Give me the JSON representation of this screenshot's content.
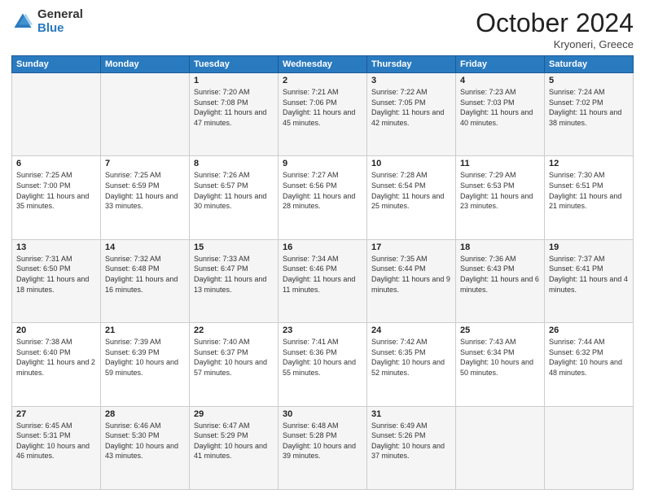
{
  "logo": {
    "general": "General",
    "blue": "Blue"
  },
  "header": {
    "month": "October 2024",
    "location": "Kryoneri, Greece"
  },
  "weekdays": [
    "Sunday",
    "Monday",
    "Tuesday",
    "Wednesday",
    "Thursday",
    "Friday",
    "Saturday"
  ],
  "weeks": [
    [
      {
        "day": "",
        "text": ""
      },
      {
        "day": "",
        "text": ""
      },
      {
        "day": "1",
        "text": "Sunrise: 7:20 AM\nSunset: 7:08 PM\nDaylight: 11 hours and 47 minutes."
      },
      {
        "day": "2",
        "text": "Sunrise: 7:21 AM\nSunset: 7:06 PM\nDaylight: 11 hours and 45 minutes."
      },
      {
        "day": "3",
        "text": "Sunrise: 7:22 AM\nSunset: 7:05 PM\nDaylight: 11 hours and 42 minutes."
      },
      {
        "day": "4",
        "text": "Sunrise: 7:23 AM\nSunset: 7:03 PM\nDaylight: 11 hours and 40 minutes."
      },
      {
        "day": "5",
        "text": "Sunrise: 7:24 AM\nSunset: 7:02 PM\nDaylight: 11 hours and 38 minutes."
      }
    ],
    [
      {
        "day": "6",
        "text": "Sunrise: 7:25 AM\nSunset: 7:00 PM\nDaylight: 11 hours and 35 minutes."
      },
      {
        "day": "7",
        "text": "Sunrise: 7:25 AM\nSunset: 6:59 PM\nDaylight: 11 hours and 33 minutes."
      },
      {
        "day": "8",
        "text": "Sunrise: 7:26 AM\nSunset: 6:57 PM\nDaylight: 11 hours and 30 minutes."
      },
      {
        "day": "9",
        "text": "Sunrise: 7:27 AM\nSunset: 6:56 PM\nDaylight: 11 hours and 28 minutes."
      },
      {
        "day": "10",
        "text": "Sunrise: 7:28 AM\nSunset: 6:54 PM\nDaylight: 11 hours and 25 minutes."
      },
      {
        "day": "11",
        "text": "Sunrise: 7:29 AM\nSunset: 6:53 PM\nDaylight: 11 hours and 23 minutes."
      },
      {
        "day": "12",
        "text": "Sunrise: 7:30 AM\nSunset: 6:51 PM\nDaylight: 11 hours and 21 minutes."
      }
    ],
    [
      {
        "day": "13",
        "text": "Sunrise: 7:31 AM\nSunset: 6:50 PM\nDaylight: 11 hours and 18 minutes."
      },
      {
        "day": "14",
        "text": "Sunrise: 7:32 AM\nSunset: 6:48 PM\nDaylight: 11 hours and 16 minutes."
      },
      {
        "day": "15",
        "text": "Sunrise: 7:33 AM\nSunset: 6:47 PM\nDaylight: 11 hours and 13 minutes."
      },
      {
        "day": "16",
        "text": "Sunrise: 7:34 AM\nSunset: 6:46 PM\nDaylight: 11 hours and 11 minutes."
      },
      {
        "day": "17",
        "text": "Sunrise: 7:35 AM\nSunset: 6:44 PM\nDaylight: 11 hours and 9 minutes."
      },
      {
        "day": "18",
        "text": "Sunrise: 7:36 AM\nSunset: 6:43 PM\nDaylight: 11 hours and 6 minutes."
      },
      {
        "day": "19",
        "text": "Sunrise: 7:37 AM\nSunset: 6:41 PM\nDaylight: 11 hours and 4 minutes."
      }
    ],
    [
      {
        "day": "20",
        "text": "Sunrise: 7:38 AM\nSunset: 6:40 PM\nDaylight: 11 hours and 2 minutes."
      },
      {
        "day": "21",
        "text": "Sunrise: 7:39 AM\nSunset: 6:39 PM\nDaylight: 10 hours and 59 minutes."
      },
      {
        "day": "22",
        "text": "Sunrise: 7:40 AM\nSunset: 6:37 PM\nDaylight: 10 hours and 57 minutes."
      },
      {
        "day": "23",
        "text": "Sunrise: 7:41 AM\nSunset: 6:36 PM\nDaylight: 10 hours and 55 minutes."
      },
      {
        "day": "24",
        "text": "Sunrise: 7:42 AM\nSunset: 6:35 PM\nDaylight: 10 hours and 52 minutes."
      },
      {
        "day": "25",
        "text": "Sunrise: 7:43 AM\nSunset: 6:34 PM\nDaylight: 10 hours and 50 minutes."
      },
      {
        "day": "26",
        "text": "Sunrise: 7:44 AM\nSunset: 6:32 PM\nDaylight: 10 hours and 48 minutes."
      }
    ],
    [
      {
        "day": "27",
        "text": "Sunrise: 6:45 AM\nSunset: 5:31 PM\nDaylight: 10 hours and 46 minutes."
      },
      {
        "day": "28",
        "text": "Sunrise: 6:46 AM\nSunset: 5:30 PM\nDaylight: 10 hours and 43 minutes."
      },
      {
        "day": "29",
        "text": "Sunrise: 6:47 AM\nSunset: 5:29 PM\nDaylight: 10 hours and 41 minutes."
      },
      {
        "day": "30",
        "text": "Sunrise: 6:48 AM\nSunset: 5:28 PM\nDaylight: 10 hours and 39 minutes."
      },
      {
        "day": "31",
        "text": "Sunrise: 6:49 AM\nSunset: 5:26 PM\nDaylight: 10 hours and 37 minutes."
      },
      {
        "day": "",
        "text": ""
      },
      {
        "day": "",
        "text": ""
      }
    ]
  ]
}
